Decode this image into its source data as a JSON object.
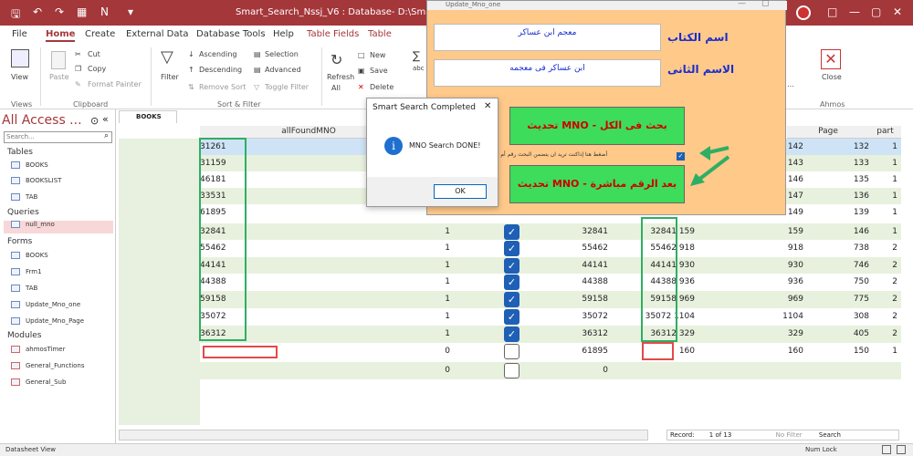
{
  "window_title": "Smart_Search_Nssj_V6 : Database- D:\\Smart_Search\\S",
  "menu_tabs": [
    "File",
    "Home",
    "Create",
    "External Data",
    "Database Tools",
    "Help",
    "Table Fields",
    "Table"
  ],
  "ribbon": {
    "view": "View",
    "views_group": "Views",
    "paste": "Paste",
    "cut": "Cut",
    "copy": "Copy",
    "format_painter": "Format Painter",
    "clipboard_group": "Clipboard",
    "filter": "Filter",
    "ascending": "Ascending",
    "descending": "Descending",
    "remove_sort": "Remove Sort",
    "selection": "Selection",
    "advanced": "Advanced",
    "toggle_filter": "Toggle Filter",
    "sort_filter_group": "Sort & Filter",
    "refresh": "Refresh",
    "refresh_all": "All",
    "new": "New",
    "save": "Save",
    "delete": "Delete",
    "close": "Close",
    "ahmos_group": "Ahmos"
  },
  "nav": {
    "title": "All Access ...",
    "search_placeholder": "Search...",
    "sections": [
      {
        "name": "Tables",
        "items": [
          "BOOKS",
          "BOOKSLIST",
          "TAB",
          "Queries"
        ]
      },
      {
        "name": "Queries",
        "items": [
          "null_mno"
        ]
      },
      {
        "name": "Forms",
        "items": [
          "BOOKS",
          "Frm1",
          "TAB",
          "Update_Mno_one",
          "Update_Mno_Page"
        ]
      },
      {
        "name": "Modules",
        "items": [
          "ahmosTimer",
          "General_Functions",
          "General_Sub"
        ]
      }
    ],
    "section_labels": {
      "tables": "Tables",
      "queries": "Queries",
      "forms": "Forms",
      "modules": "Modules"
    },
    "tables": [
      "BOOKS",
      "BOOKSLIST",
      "TAB"
    ],
    "queries": [
      "null_mno"
    ],
    "forms": [
      "BOOKS",
      "Frm1",
      "TAB",
      "Update_Mno_one",
      "Update_Mno_Page"
    ],
    "modules": [
      "ahmosTimer",
      "General_Functions",
      "General_Sub"
    ]
  },
  "doc_tab": "BOOKS",
  "columns": {
    "all_found": "allFoundMNO",
    "page": "Page",
    "part": "part"
  },
  "rows": [
    {
      "a": "31261",
      "b": "",
      "d": "",
      "e": "",
      "f": "142",
      "g": "132",
      "h": "1"
    },
    {
      "a": "31159",
      "b": "",
      "d": "",
      "e": "",
      "f": "143",
      "g": "133",
      "h": "1"
    },
    {
      "a": "46181",
      "b": "",
      "d": "",
      "e": "",
      "f": "146",
      "g": "135",
      "h": "1"
    },
    {
      "a": "33531",
      "b": "",
      "d": "",
      "e": "",
      "f": "147",
      "g": "136",
      "h": "1"
    },
    {
      "a": "61895",
      "b": "",
      "d": "",
      "e": "",
      "f": "149",
      "g": "139",
      "h": "1"
    },
    {
      "a": "32841",
      "b": "1",
      "d": "32841",
      "e": "32841 159",
      "f": "159",
      "g": "146",
      "h": "1"
    },
    {
      "a": "55462",
      "b": "1",
      "d": "55462",
      "e": "55462 918",
      "f": "918",
      "g": "738",
      "h": "2"
    },
    {
      "a": "44141",
      "b": "1",
      "d": "44141",
      "e": "44141 930",
      "f": "930",
      "g": "746",
      "h": "2"
    },
    {
      "a": "44388",
      "b": "1",
      "d": "44388",
      "e": "44388 936",
      "f": "936",
      "g": "750",
      "h": "2"
    },
    {
      "a": "59158",
      "b": "1",
      "d": "59158",
      "e": "59158 969",
      "f": "969",
      "g": "775",
      "h": "2"
    },
    {
      "a": "35072",
      "b": "1",
      "d": "35072",
      "e": "35072 1104",
      "f": "1104",
      "g": "308",
      "h": "2"
    },
    {
      "a": "36312",
      "b": "1",
      "d": "36312",
      "e": "36312 329",
      "f": "329",
      "g": "405",
      "h": "2"
    },
    {
      "a": "",
      "b": "0",
      "d": "61895",
      "e": "160",
      "f": "160",
      "g": "150",
      "h": "1"
    },
    {
      "a": "",
      "b": "0",
      "d": "0",
      "e": "",
      "f": "",
      "g": "",
      "h": ""
    }
  ],
  "form": {
    "title": "Update_Mno_one",
    "book_name_label": "اسم الكتاب",
    "book_name_value": "معجم ابن عساكر",
    "second_name_label": "الاسم الثانى",
    "second_name_value": "ابن عساكر فى معجمه",
    "update_all_button": "تحديث MNO - بحث فى الكل",
    "checkbox_label": "أضغط هنا إذاكنت تريد ان يتضمن البحث رقم أم لا",
    "update_direct_button": "تحديث MNO - بعد الرقم مباشرة"
  },
  "dialog": {
    "title": "Smart Search Completed",
    "message": "MNO Search DONE!",
    "ok": "OK"
  },
  "status": {
    "left": "Datasheet View",
    "record_label": "Record:",
    "record_pos": "1 of 13",
    "no_filter": "No Filter",
    "search": "Search",
    "num_lock": "Num Lock"
  }
}
